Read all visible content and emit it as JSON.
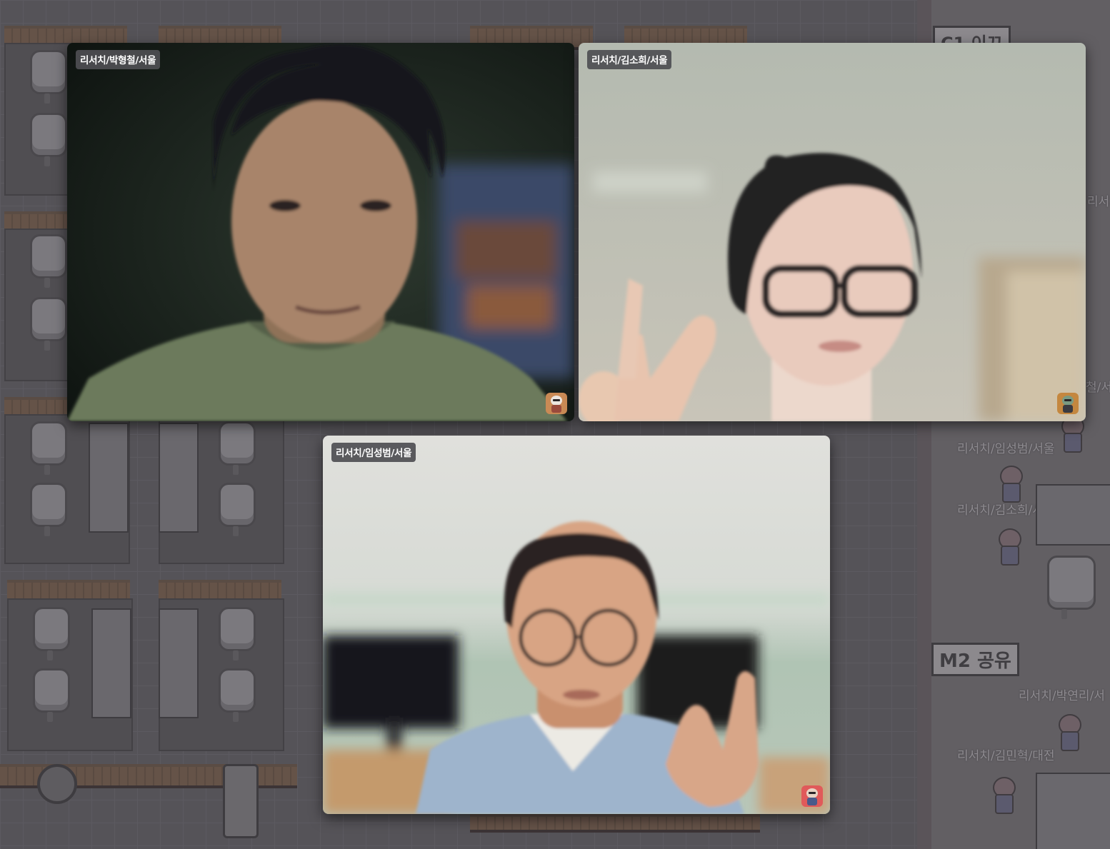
{
  "background": {
    "room_signs": [
      "C1 이끄",
      "M2 공유"
    ],
    "avatar_names": [
      "리서치/임성범/서울",
      "리서치/김소희/서울",
      "리서치/박연리/서",
      "리서치/김민혁/대전"
    ],
    "partial_names": [
      "리서치",
      "철/서"
    ]
  },
  "participants": [
    {
      "name": "리서치/박형철/서울",
      "avatar_color": "#c98a55",
      "avatar_icon": "white-haired-avatar-icon"
    },
    {
      "name": "리서치/김소희/서울",
      "avatar_color": "#c4873f",
      "avatar_icon": "horned-avatar-icon"
    },
    {
      "name": "리서치/임성범/서울",
      "avatar_color": "#e05a5a",
      "avatar_icon": "capped-avatar-icon"
    }
  ]
}
